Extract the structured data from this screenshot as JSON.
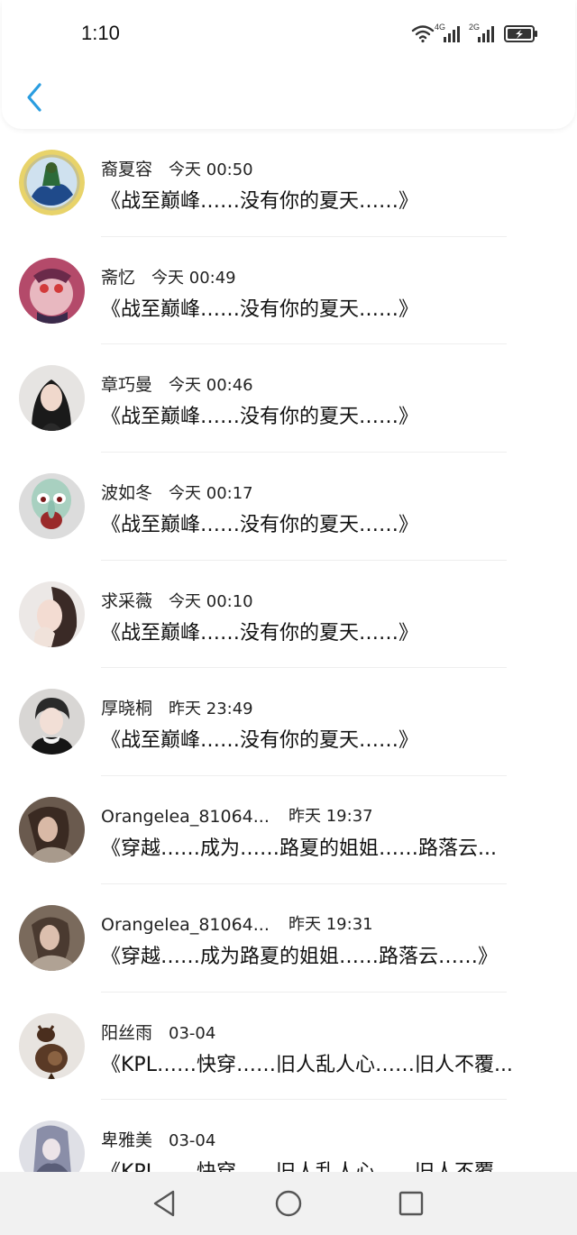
{
  "status_bar": {
    "time": "1:10",
    "net1": "4G",
    "net2": "2G"
  },
  "header": {
    "back_icon": "chevron-left-icon",
    "accent_color": "#2a9de0"
  },
  "messages": [
    {
      "name": "裔夏容",
      "time": "今天 00:50",
      "text": "《战至巅峰……没有你的夏天……》"
    },
    {
      "name": "斋忆",
      "time": "今天 00:49",
      "text": "《战至巅峰……没有你的夏天……》"
    },
    {
      "name": "章巧曼",
      "time": "今天 00:46",
      "text": "《战至巅峰……没有你的夏天……》"
    },
    {
      "name": "波如冬",
      "time": "今天 00:17",
      "text": "《战至巅峰……没有你的夏天……》"
    },
    {
      "name": "求采薇",
      "time": "今天 00:10",
      "text": "《战至巅峰……没有你的夏天……》"
    },
    {
      "name": "厚晓桐",
      "time": "昨天 23:49",
      "text": "《战至巅峰……没有你的夏天……》"
    },
    {
      "name": "Orangelea_81064...",
      "time": "昨天 19:37",
      "text": "《穿越……成为……路夏的姐姐……路落云..."
    },
    {
      "name": "Orangelea_81064...",
      "time": "昨天 19:31",
      "text": "《穿越……成为路夏的姐姐……路落云……》"
    },
    {
      "name": "阳丝雨",
      "time": "03-04",
      "text": "《KPL……快穿……旧人乱人心……旧人不覆..."
    },
    {
      "name": "卑雅美",
      "time": "03-04",
      "text": "《KPL……快穿……旧人乱人心……旧人不覆..."
    }
  ],
  "nav": {
    "back": "triangle-back-icon",
    "home": "circle-home-icon",
    "recents": "square-recents-icon"
  }
}
